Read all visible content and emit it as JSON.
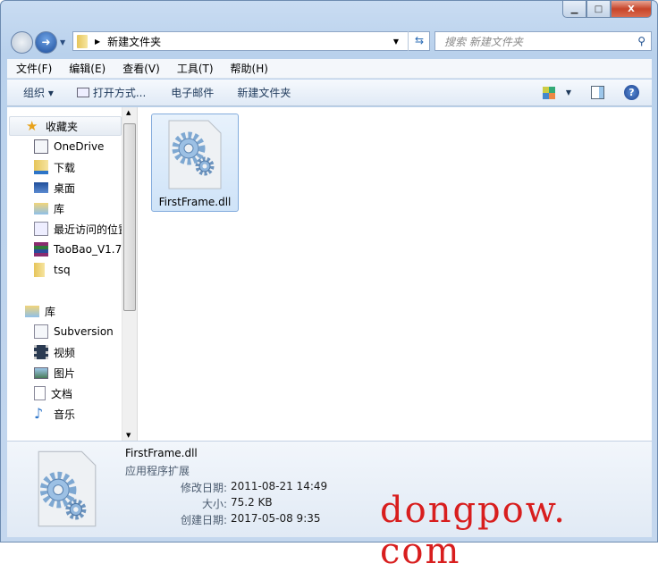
{
  "window": {
    "controls": {
      "minimize": "▭",
      "maximize": "□",
      "close": "X"
    }
  },
  "address": {
    "path": "新建文件夹",
    "search_placeholder": "搜索 新建文件夹"
  },
  "menu": [
    "文件(F)",
    "编辑(E)",
    "查看(V)",
    "工具(T)",
    "帮助(H)"
  ],
  "toolbar": {
    "organize": "组织 ▾",
    "open_with": "打开方式...",
    "email": "电子邮件",
    "new_folder": "新建文件夹"
  },
  "nav": {
    "favorites": {
      "label": "收藏夹",
      "items": [
        "OneDrive",
        "下载",
        "桌面",
        "库",
        "最近访问的位置",
        "TaoBao_V1.7",
        "tsq"
      ]
    },
    "libraries": {
      "label": "库",
      "items": [
        "Subversion",
        "视频",
        "图片",
        "文档",
        "音乐"
      ]
    }
  },
  "files": [
    {
      "name": "FirstFrame.dll",
      "icon": "dll-gear-icon"
    }
  ],
  "details": {
    "name": "FirstFrame.dll",
    "type": "应用程序扩展",
    "rows": [
      {
        "k": "修改日期:",
        "v": "2011-08-21 14:49"
      },
      {
        "k": "大小:",
        "v": "75.2 KB"
      },
      {
        "k": "创建日期:",
        "v": "2017-05-08 9:35"
      }
    ]
  },
  "watermark": "dongpow. com",
  "colors": {
    "selection": "#cfe3f8",
    "watermark": "#d81e1e"
  }
}
